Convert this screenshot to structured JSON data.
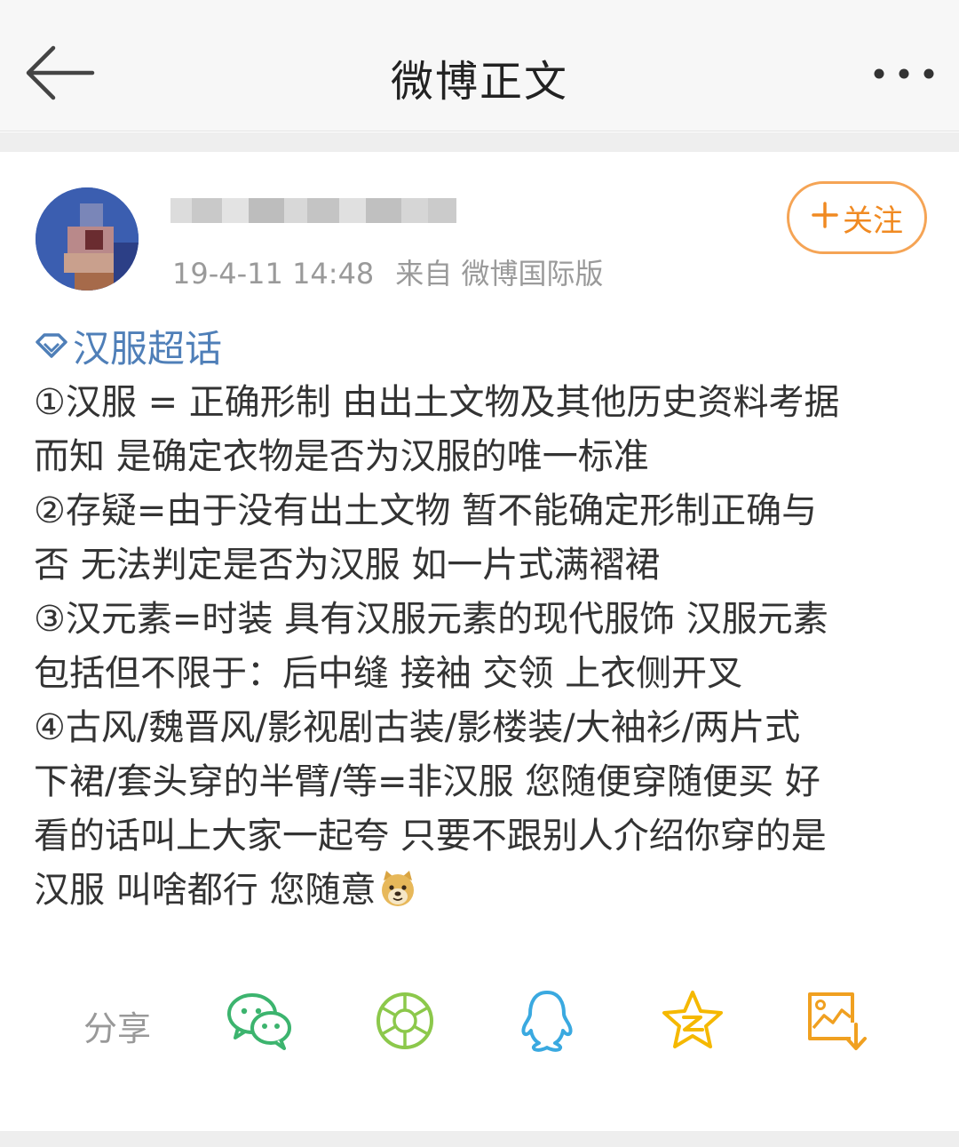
{
  "header": {
    "title": "微博正文",
    "back_icon": "arrow-left-icon",
    "more_icon": "more-dots-icon"
  },
  "post": {
    "timestamp": "19-4-11 14:48",
    "source": "来自 微博国际版",
    "follow_label": "关注",
    "follow_icon": "plus-icon",
    "supertopic": "汉服超话",
    "supertopic_icon": "diamond-icon",
    "lines": [
      "①汉服 = 正确形制 由出土文物及其他历史资料考据",
      "而知 是确定衣物是否为汉服的唯一标准",
      "②存疑=由于没有出土文物 暂不能确定形制正确与",
      "否 无法判定是否为汉服 如一片式满褶裙",
      "③汉元素=时装 具有汉服元素的现代服饰 汉服元素",
      "包括但不限于：后中缝 接袖 交领 上衣侧开叉",
      "④古风/魏晋风/影视剧古装/影楼装/大袖衫/两片式",
      "下裙/套头穿的半臂/等=非汉服 您随便穿随便买 好",
      "看的话叫上大家一起夸 只要不跟别人介绍你穿的是",
      "汉服 叫啥都行 您随意"
    ],
    "emoji": "doge-emoji"
  },
  "share": {
    "label": "分享",
    "icons": [
      "wechat-icon",
      "moments-icon",
      "qq-icon",
      "qzone-icon",
      "save-image-icon"
    ]
  },
  "colors": {
    "accent_orange": "#f08a22",
    "link_blue": "#4f7fb8",
    "wechat_green": "#3cb46e",
    "moments_green": "#8cc84b",
    "qq_blue": "#3aa9e0",
    "qzone_yellow": "#f5b800",
    "save_orange": "#f0a020"
  }
}
